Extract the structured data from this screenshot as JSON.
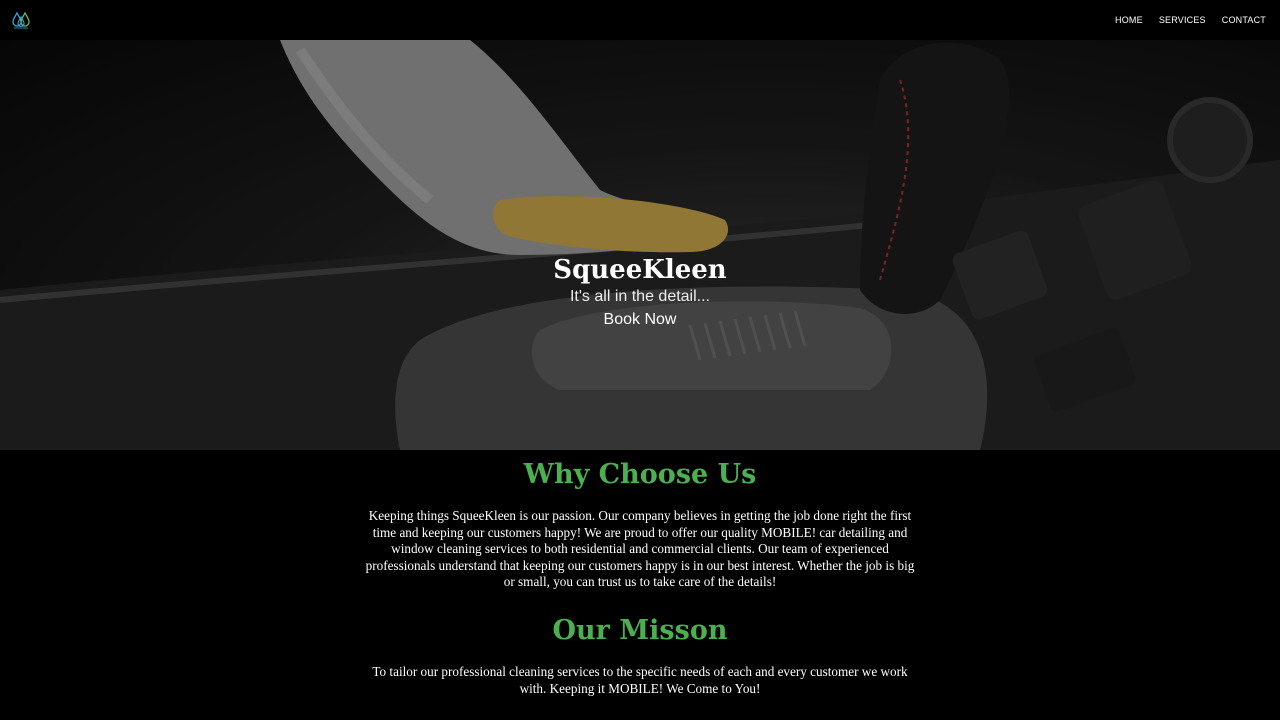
{
  "header": {
    "logo_icon": "water-drops-logo",
    "nav": [
      {
        "label": "HOME"
      },
      {
        "label": "SERVICES"
      },
      {
        "label": "CONTACT"
      }
    ]
  },
  "hero": {
    "title": "SqueeKleen",
    "subtitle": "It's all in the detail...",
    "cta_label": "Book Now"
  },
  "why": {
    "heading": "Why Choose Us",
    "body": "Keeping things SqueeKleen is our passion. Our company believes in getting the job done right the first time and keeping our customers happy! We are proud to offer our quality MOBILE! car detailing and window cleaning services to both residential and commercial clients. Our team of experienced professionals understand that keeping our customers happy is in our best interest. Whether the job is big or small, you can trust us to take care of the details!"
  },
  "mission": {
    "heading": "Our Misson",
    "body": "To tailor our professional cleaning services to the specific needs of each and every customer we work with. Keeping it MOBILE! We Come to You!"
  },
  "colors": {
    "accent": "#4caf50",
    "logo_blue": "#3ea6d8",
    "logo_green": "#5cc06a",
    "background": "#000000"
  }
}
